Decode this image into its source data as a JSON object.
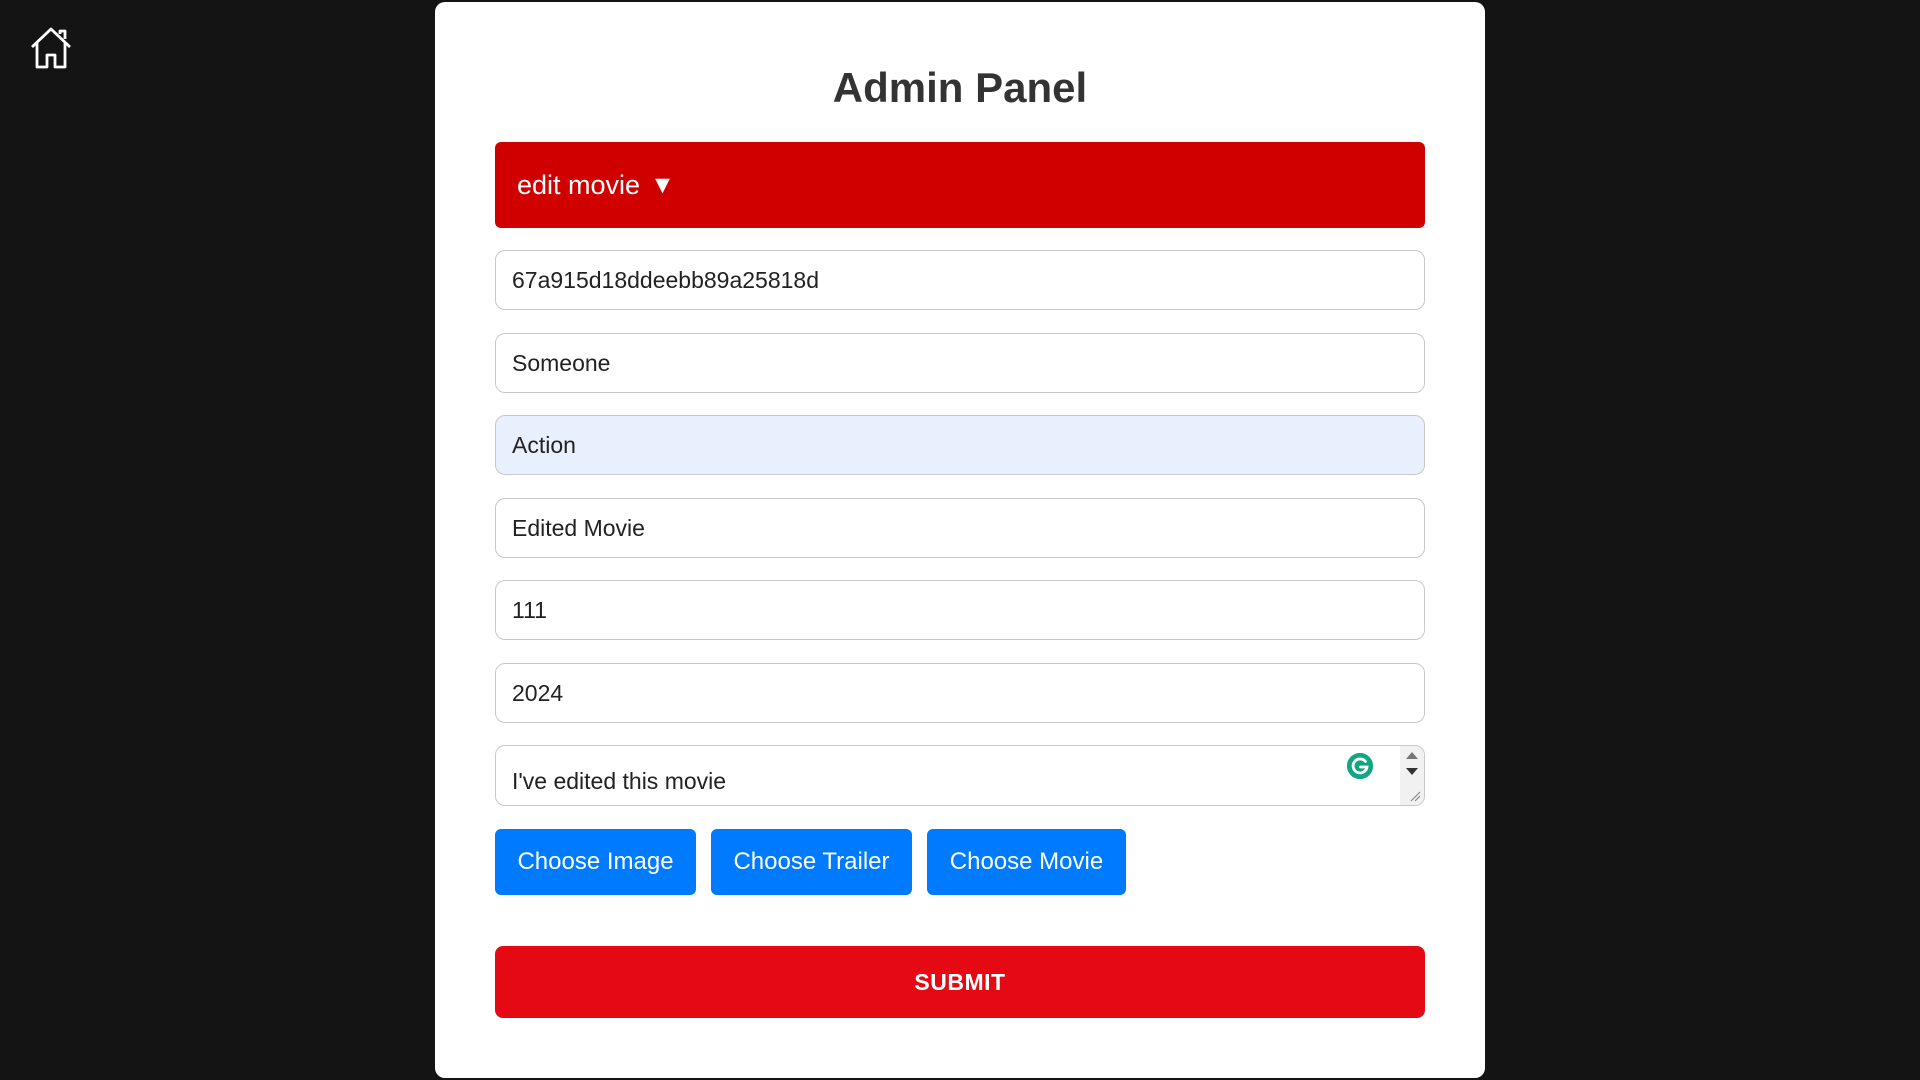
{
  "nav": {
    "home_icon": "home-icon"
  },
  "panel": {
    "title": "Admin Panel",
    "mode_select": {
      "label": "edit movie",
      "arrow": "▼"
    }
  },
  "form": {
    "movie_id": "67a915d18ddeebb89a25818d",
    "director": "Someone",
    "genre": "Action",
    "title": "Edited Movie",
    "duration": "111",
    "year": "2024",
    "description": "I've edited this movie",
    "buttons": {
      "choose_image": "Choose Image",
      "choose_trailer": "Choose Trailer",
      "choose_movie": "Choose Movie",
      "submit": "SUBMIT"
    }
  },
  "colors": {
    "background": "#141414",
    "panel": "#ffffff",
    "mode_select": "#d10000",
    "file_button": "#007bff",
    "submit": "#e50914",
    "autofill": "#e8f0fe"
  }
}
